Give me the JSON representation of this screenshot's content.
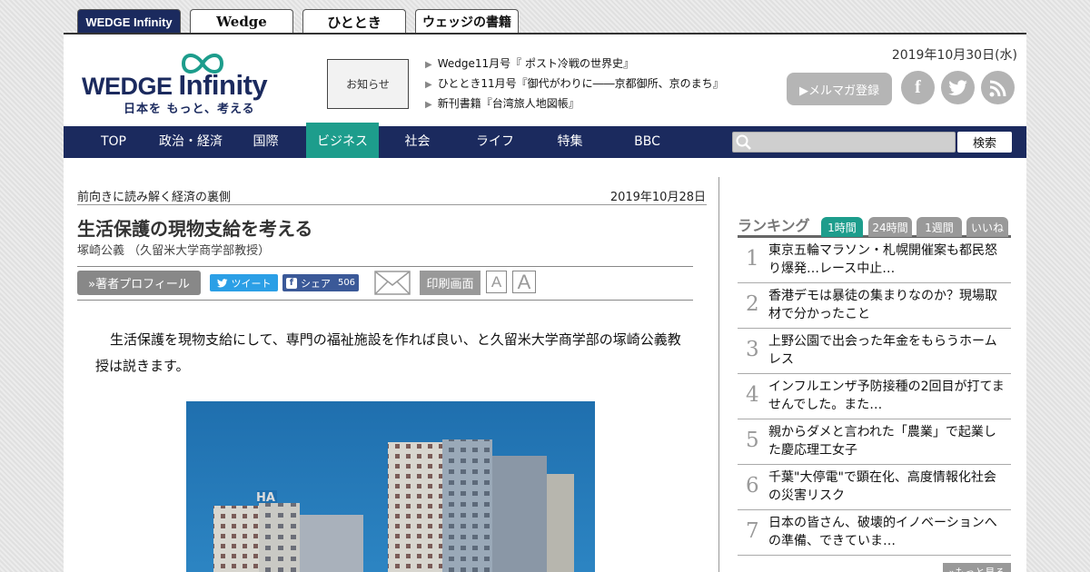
{
  "topnav": {
    "sites": [
      {
        "label": "WEDGE Infinity"
      },
      {
        "label": "Wedge"
      },
      {
        "label": "ひととき"
      },
      {
        "label": "ウェッジの書籍"
      }
    ]
  },
  "header": {
    "logo_word": "WEDGE",
    "logo_word2": "Infinity",
    "tagline": "日本を もっと、考える",
    "notice_label": "お知らせ",
    "news": [
      "Wedge11月号『 ポスト冷戦の世界史』",
      "ひととき11月号『御代がわりに――京都御所、京のまち』",
      "新刊書籍『台湾旅人地図帳』"
    ],
    "date": "2019年10月30日(水)",
    "newsletter_label": "▶メルマガ登録",
    "social": {
      "facebook": "f",
      "twitter": "twitter-icon",
      "rss": "rss-icon"
    }
  },
  "nav": {
    "items": [
      "TOP",
      "政治・経済",
      "国際",
      "ビジネス",
      "社会",
      "ライフ",
      "特集",
      "BBC"
    ],
    "active": "ビジネス",
    "search_button": "検索"
  },
  "article": {
    "kicker": "前向きに読み解く経済の裏側",
    "date": "2019年10月28日",
    "title": "生活保護の現物支給を考える",
    "author": "塚崎公義 （久留米大学商学部教授）",
    "profile_button": "»著者プロフィール",
    "tweet_label": "ツイート",
    "share_label": "シェア",
    "share_count": "506",
    "print_label": "印刷画面",
    "font_small": "A",
    "font_large": "A",
    "lead": "生活保護を現物支給にして、専門の福祉施設を作れば良い、と久留米大学商学部の塚崎公義教授は説きます。"
  },
  "sidebar": {
    "ranking_title": "ランキング",
    "tabs": [
      "1時間",
      "24時間",
      "1週間",
      "いいね"
    ],
    "active_tab": "1時間",
    "items": [
      {
        "num": "1",
        "text": "東京五輪マラソン・札幌開催案も都民怒り爆発…レース中止…"
      },
      {
        "num": "2",
        "text": "香港デモは暴徒の集まりなのか？現場取材で分かったこと"
      },
      {
        "num": "3",
        "text": "上野公園で出会った年金をもらうホームレス"
      },
      {
        "num": "4",
        "text": "インフルエンザ予防接種の2回目が打てませんでした。また…"
      },
      {
        "num": "5",
        "text": "親からダメと言われた「農業」で起業した慶応理工女子"
      },
      {
        "num": "6",
        "text": "千葉\"大停電\"で顕在化、高度情報化社会の災害リスク"
      },
      {
        "num": "7",
        "text": "日本の皆さん、破壊的イノベーションへの準備、できていま…"
      }
    ],
    "more_label": "»もっと見る"
  },
  "colors": {
    "navy": "#1b2a5e",
    "teal": "#1d9d8c",
    "twitter": "#2b9fe6",
    "facebook": "#3b5998"
  }
}
